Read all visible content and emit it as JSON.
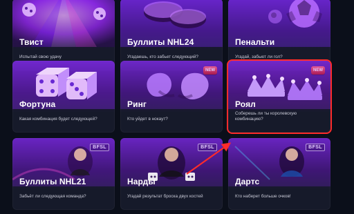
{
  "games": [
    {
      "id": "tvist",
      "title": "Твист",
      "subtitle": "Испытай свою удачу",
      "icon": "wheel-icon",
      "badge": ""
    },
    {
      "id": "bullets-nhl24",
      "title": "Буллиты NHL24",
      "subtitle": "Угадаешь, кто забьет следующий?",
      "icon": "puck-icon",
      "badge": ""
    },
    {
      "id": "penalty",
      "title": "Пенальти",
      "subtitle": "Угадай, забьют ли гол?",
      "icon": "soccer-ball-icon",
      "badge": ""
    },
    {
      "id": "fortuna",
      "title": "Фортуна",
      "subtitle": "Какая комбинация будет следующей?",
      "icon": "dice-icon",
      "badge": ""
    },
    {
      "id": "ring",
      "title": "Ринг",
      "subtitle": "Кто уйдет в нокаут?",
      "icon": "boxing-gloves-icon",
      "badge": "NEW"
    },
    {
      "id": "royal",
      "title": "Роял",
      "subtitle": "Соберешь ли ты королевскую\nкомбинацию?",
      "icon": "crowns-icon",
      "badge": "NEW"
    },
    {
      "id": "bullets-nhl21",
      "title": "Буллиты NHL21",
      "subtitle": "Забьёт ли следующая команда?",
      "icon": "dealer-icon",
      "badge": "BFSL"
    },
    {
      "id": "nardy",
      "title": "Нарды",
      "subtitle": "Угадай результат броска двух костей",
      "icon": "dealer-icon",
      "badge": "BFSL"
    },
    {
      "id": "darts",
      "title": "Дартс",
      "subtitle": "Кто наберет больше очков!",
      "icon": "dealer-icon",
      "badge": "BFSL"
    }
  ],
  "selected_game_id": "royal",
  "colors": {
    "accent": "#ff2b2b",
    "purple": "#8d2cff"
  }
}
